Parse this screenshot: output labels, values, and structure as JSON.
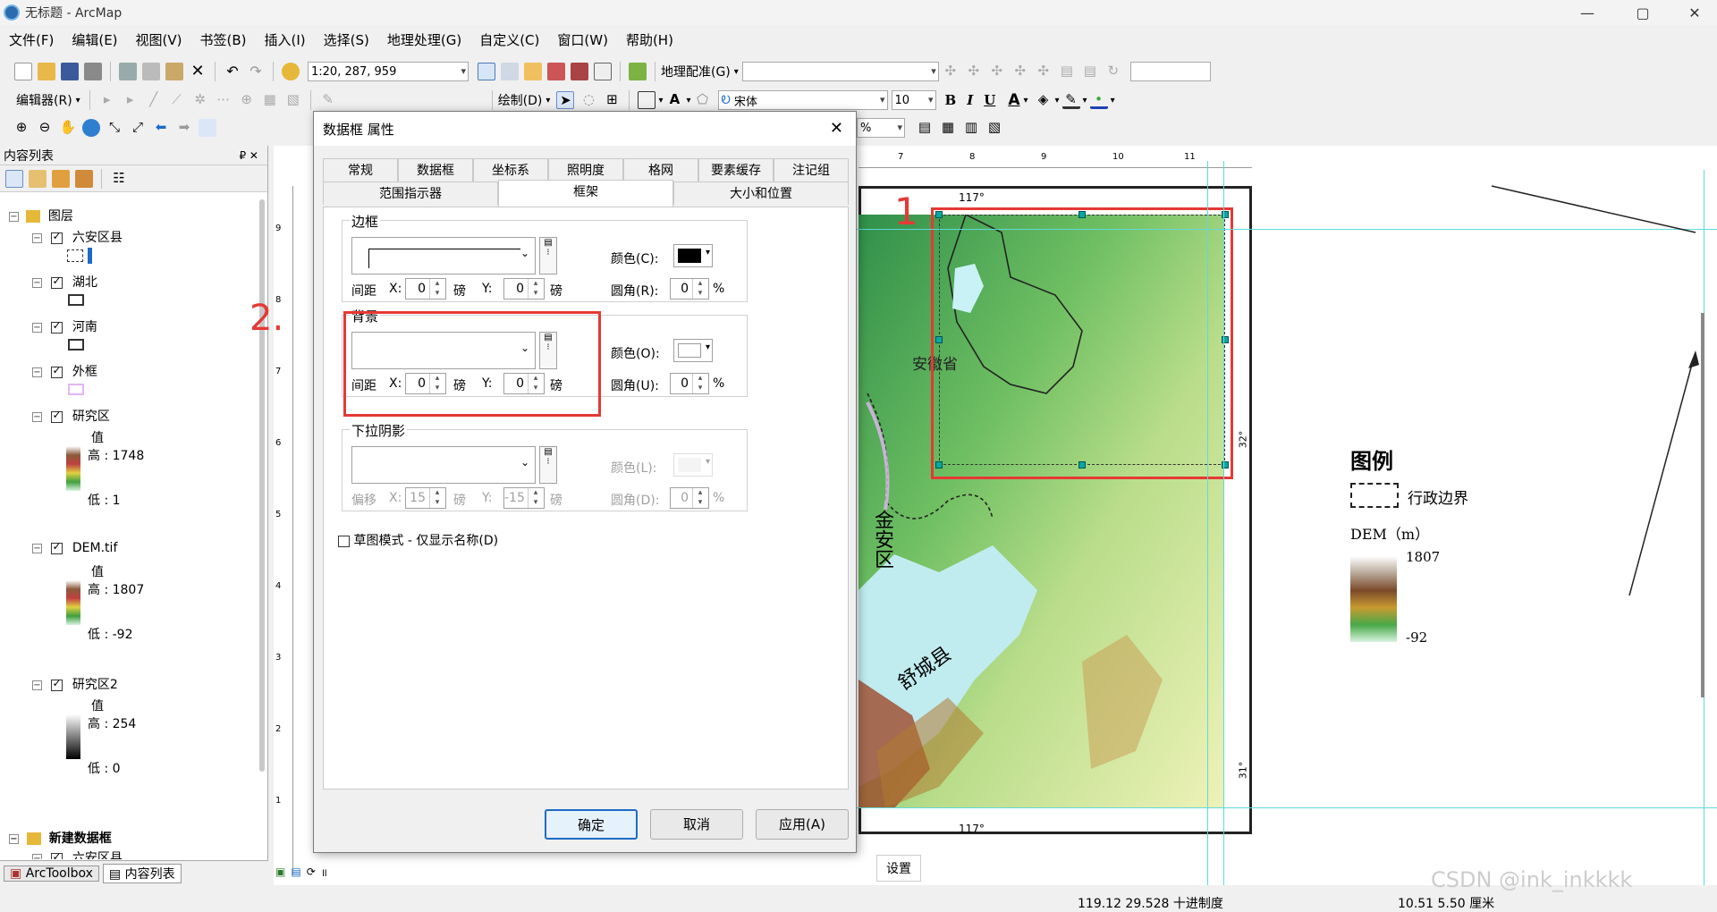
{
  "window": {
    "title": "无标题 - ArcMap",
    "min": "—",
    "max": "▢",
    "close": "✕"
  },
  "menu": [
    "文件(F)",
    "编辑(E)",
    "视图(V)",
    "书签(B)",
    "插入(I)",
    "选择(S)",
    "地理处理(G)",
    "自定义(C)",
    "窗口(W)",
    "帮助(H)"
  ],
  "toolbar": {
    "scale": "1:20, 287, 959",
    "georef": "地理配准(G)",
    "editor": "编辑器(R)",
    "draw": "绘制(D)",
    "font": "宋体",
    "fontsize": "10",
    "bold": "B",
    "italic": "I",
    "underline": "U",
    "fontcolor": "A",
    "zoom_pct": "%"
  },
  "toc": {
    "title": "内容列表",
    "pin": "₽ ✕",
    "root": "图层",
    "layers": [
      {
        "name": "六安区县"
      },
      {
        "name": "湖北"
      },
      {
        "name": "河南"
      },
      {
        "name": "外框"
      },
      {
        "name": "研究区",
        "value": "值",
        "high": "高 : 1748",
        "low": "低 : 1"
      },
      {
        "name": "DEM.tif",
        "value": "值",
        "high": "高 : 1807",
        "low": "低 : -92"
      },
      {
        "name": "研究区2",
        "value": "值",
        "high": "高 : 254",
        "low": "低 : 0"
      }
    ],
    "newframe": "新建数据框",
    "newframe_child": "六安区县",
    "tabs": [
      "ArcToolbox",
      "内容列表"
    ]
  },
  "dialog": {
    "title": "数据框 属性",
    "close": "✕",
    "tabs_row1": [
      "常规",
      "数据框",
      "坐标系",
      "照明度",
      "格网",
      "要素缓存",
      "注记组"
    ],
    "tabs_row2": [
      "范围指示器",
      "框架",
      "大小和位置"
    ],
    "active_tab": "框架",
    "border": {
      "label": "边框",
      "color_label": "颜色(C):",
      "gap_label": "间距",
      "x_label": "X:",
      "x": "0",
      "unit": "磅",
      "y_label": "Y:",
      "y": "0",
      "round_label": "圆角(R):",
      "round": "0",
      "pct": "%"
    },
    "background": {
      "label": "背景",
      "color_label": "颜色(O):",
      "gap_label": "间距",
      "x_label": "X:",
      "x": "0",
      "unit": "磅",
      "y_label": "Y:",
      "y": "0",
      "round_label": "圆角(U):",
      "round": "0",
      "pct": "%"
    },
    "shadow": {
      "label": "下拉阴影",
      "color_label": "颜色(L):",
      "offset_label": "偏移",
      "x_label": "X:",
      "x": "15",
      "unit": "磅",
      "y_label": "Y:",
      "y": "-15",
      "round_label": "圆角(D):",
      "round": "0",
      "pct": "%"
    },
    "draft": "草图模式 - 仅显示名称(D)",
    "ok": "确定",
    "cancel": "取消",
    "apply": "应用(A)"
  },
  "annotations": {
    "one": "1",
    "two": "2."
  },
  "map": {
    "lon_top": "117°",
    "lon_bottom": "117°",
    "lat_right1": "32°",
    "lat_right2": "31°",
    "province": "安徽省",
    "county1": "金安区",
    "county2": "舒城县",
    "ruler_ticks": [
      "7",
      "8",
      "9",
      "10",
      "11"
    ],
    "vruler_ticks": [
      "9",
      "8",
      "7",
      "6",
      "5",
      "4",
      "3",
      "2",
      "1"
    ]
  },
  "legend": {
    "title": "图例",
    "boundary": "行政边界",
    "dem": "DEM（m）",
    "high": "1807",
    "low": "-92"
  },
  "status": {
    "settings": "设置",
    "coords": "119.12  29.528 十进制度",
    "size": "10.51  5.50 厘米",
    "watermark": "CSDN @ink_inkkkk"
  },
  "colors": {
    "red": "#e53935",
    "accent": "#0ea5a0",
    "dem_high": "#7a4a2a",
    "dem_low": "#d9f3e0"
  }
}
